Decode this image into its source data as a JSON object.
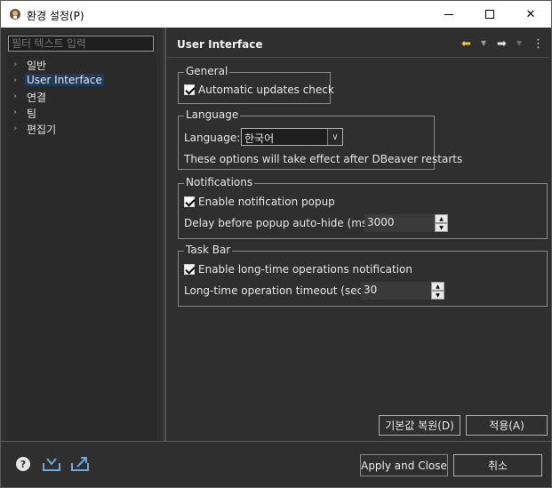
{
  "window": {
    "title": "환경 설정(P)"
  },
  "sidebar": {
    "filter_placeholder": "필터 텍스트 입력",
    "items": [
      {
        "label": "일반"
      },
      {
        "label": "User Interface"
      },
      {
        "label": "연결"
      },
      {
        "label": "팀"
      },
      {
        "label": "편집기"
      }
    ]
  },
  "page": {
    "title": "User Interface"
  },
  "general": {
    "title": "General",
    "auto_updates": "Automatic updates check"
  },
  "language": {
    "title": "Language",
    "label": "Language:",
    "selected": "한국어",
    "note": "These options will take effect after DBeaver restarts"
  },
  "notifications": {
    "title": "Notifications",
    "enable": "Enable notification popup",
    "delay_label": "Delay before popup auto-hide (ms):",
    "delay_value": "3000"
  },
  "taskbar": {
    "title": "Task Bar",
    "enable": "Enable long-time operations notification",
    "timeout_label": "Long-time operation timeout (sec):",
    "timeout_value": "30"
  },
  "buttons": {
    "restore": "기본값 복원(D)",
    "apply": "적용(A)",
    "apply_close": "Apply and Close",
    "cancel": "취소"
  },
  "colors": {
    "accent": "#4a90e2",
    "selection": "#1f3a5a",
    "nav_arrow": "#f0c14b"
  }
}
